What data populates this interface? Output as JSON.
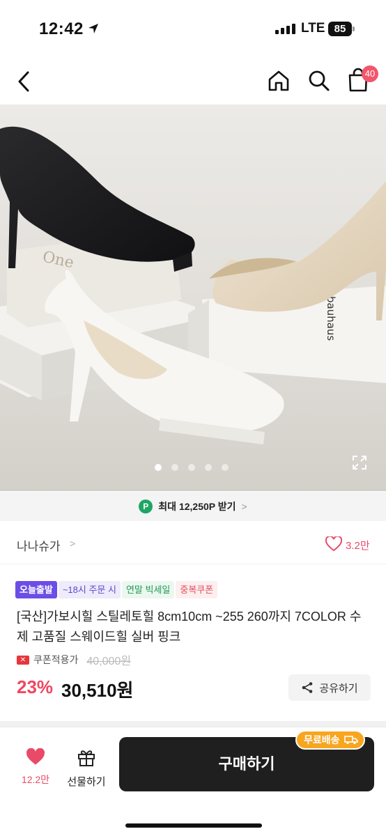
{
  "status_bar": {
    "time": "12:42",
    "network": "LTE",
    "battery": "85"
  },
  "nav": {
    "bag_count": "40"
  },
  "hero": {
    "slide_count": 5,
    "active_slide": 1,
    "box_text_1": "bauhaus",
    "box_text_2": "One"
  },
  "point_banner": {
    "badge": "P",
    "text": "최대 12,250P 받기",
    "arrow": ">"
  },
  "seller": {
    "name": "나나슈가",
    "arrow": ">",
    "likes": "3.2만"
  },
  "tags": [
    {
      "label": "오늘출발"
    },
    {
      "label": "~18시 주문 시"
    },
    {
      "label": "연말 빅세일"
    },
    {
      "label": "중복쿠폰"
    }
  ],
  "product": {
    "title": "[국산]가보시힐 스틸레토힐 8cm10cm ~255 260까지 7COLOR 수제 고품질 스웨이드힐 실버 핑크",
    "coupon_label": "쿠폰적용가",
    "original_price": "40,000원",
    "discount": "23%",
    "price": "30,510원"
  },
  "share": {
    "label": "공유하기"
  },
  "bottom_bar": {
    "likes": "12.2만",
    "gift_label": "선물하기",
    "buy_label": "구매하기",
    "free_shipping": "무료배송"
  },
  "colors": {
    "accent_pink": "#ef4763",
    "point_green": "#1fa564",
    "free_ship_orange": "#f8a51f",
    "buy_dark": "#1f1f1f"
  }
}
